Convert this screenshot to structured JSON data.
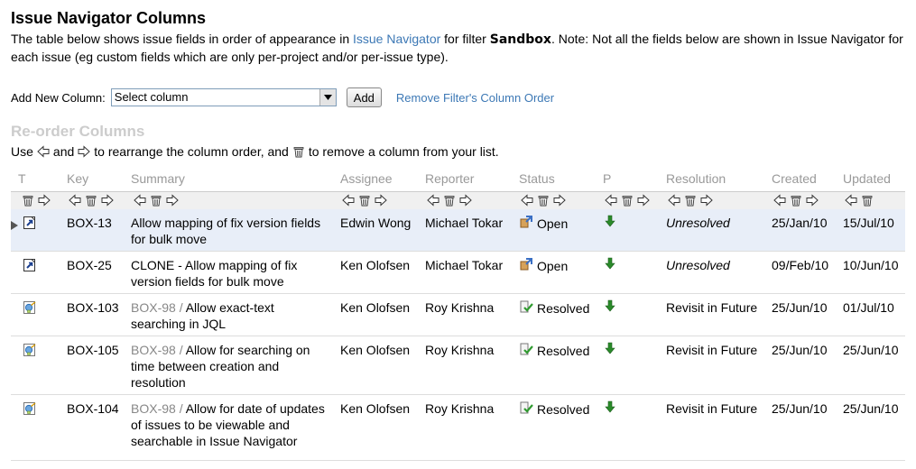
{
  "page": {
    "title": "Issue Navigator Columns",
    "desc_pre": "The table below shows issue fields in order of appearance in ",
    "desc_link": "Issue Navigator",
    "desc_mid": " for filter ",
    "desc_filter": "Sandbox",
    "desc_post": ". Note: Not all the fields below are shown in Issue Navigator for each issue (eg custom fields which are only per-project and/or per-issue type)."
  },
  "add": {
    "label": "Add New Column:",
    "select_value": "Select column",
    "add_button": "Add",
    "remove_link": "Remove Filter's Column Order"
  },
  "reorder": {
    "title": "Re-order Columns",
    "hint_1": "Use",
    "hint_2": "and",
    "hint_3": "to rearrange the column order, and",
    "hint_4": "to remove a column from your list."
  },
  "columns": [
    "T",
    "Key",
    "Summary",
    "Assignee",
    "Reporter",
    "Status",
    "P",
    "Resolution",
    "Created",
    "Updated"
  ],
  "rows": [
    {
      "type": "sub-task",
      "key": "BOX-13",
      "parent": "",
      "summary": "Allow mapping of fix version fields for bulk move",
      "assignee": "Edwin Wong",
      "reporter": "Michael Tokar",
      "status": "Open",
      "resolution": "Unresolved",
      "created": "25/Jan/10",
      "updated": "15/Jul/10"
    },
    {
      "type": "sub-task",
      "key": "BOX-25",
      "parent": "",
      "summary": "CLONE - Allow mapping of fix version fields for bulk move",
      "assignee": "Ken Olofsen",
      "reporter": "Michael Tokar",
      "status": "Open",
      "resolution": "Unresolved",
      "created": "09/Feb/10",
      "updated": "10/Jun/10"
    },
    {
      "type": "improvement",
      "key": "BOX-103",
      "parent": "BOX-98",
      "summary": "Allow exact-text searching in JQL",
      "assignee": "Ken Olofsen",
      "reporter": "Roy Krishna",
      "status": "Resolved",
      "resolution": "Revisit in Future",
      "created": "25/Jun/10",
      "updated": "01/Jul/10"
    },
    {
      "type": "improvement",
      "key": "BOX-105",
      "parent": "BOX-98",
      "summary": "Allow for searching on time between creation and resolution",
      "assignee": "Ken Olofsen",
      "reporter": "Roy Krishna",
      "status": "Resolved",
      "resolution": "Revisit in Future",
      "created": "25/Jun/10",
      "updated": "25/Jun/10"
    },
    {
      "type": "improvement",
      "key": "BOX-104",
      "parent": "BOX-98",
      "summary": "Allow for date of updates of issues to be viewable and searchable in Issue Navigator",
      "assignee": "Ken Olofsen",
      "reporter": "Roy Krishna",
      "status": "Resolved",
      "resolution": "Revisit in Future",
      "created": "25/Jun/10",
      "updated": "25/Jun/10"
    }
  ],
  "colors": {
    "link": "#3c78b5",
    "header": "#999999",
    "section": "#cccccc",
    "selected_row": "#e8eef8",
    "priority_arrow": "#2a8a2a"
  }
}
